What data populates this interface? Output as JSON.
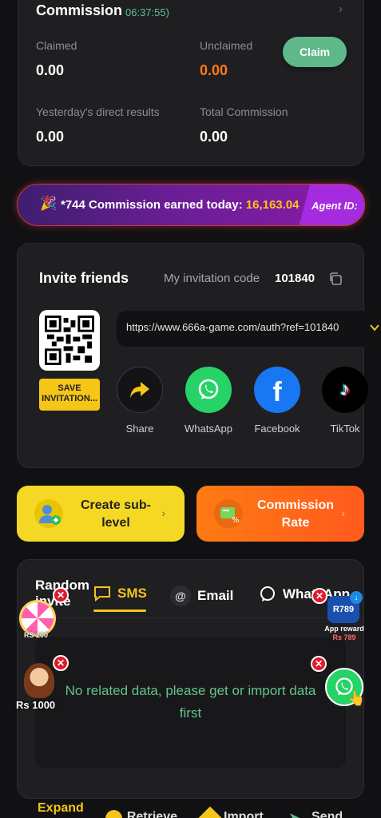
{
  "commission": {
    "title": "Commission",
    "countdown": "06:37:55)",
    "claimed_label": "Claimed",
    "claimed_value": "0.00",
    "unclaimed_label": "Unclaimed",
    "unclaimed_value": "0.00",
    "claim_button": "Claim",
    "yesterday_label": "Yesterday's direct results",
    "yesterday_value": "0.00",
    "total_label": "Total Commission",
    "total_value": "0.00"
  },
  "banner": {
    "text": "*744 Commission earned today: ",
    "amount": "16,163.04",
    "agent_label": "Agent ID:"
  },
  "invite": {
    "title": "Invite friends",
    "code_label": "My invitation code",
    "code_value": "101840",
    "save_button": "SAVE INVITATION...",
    "url": "https://www.666a-game.com/auth?ref=101840",
    "share": [
      {
        "label": "Share"
      },
      {
        "label": "WhatsApp"
      },
      {
        "label": "Facebook"
      },
      {
        "label": "TikTok"
      }
    ]
  },
  "actions": {
    "create_sub_level": "Create sub-level",
    "commission_rate": "Commission Rate"
  },
  "random_invite": {
    "title": "Random invite",
    "tabs": [
      {
        "label": "SMS",
        "active": true
      },
      {
        "label": "Email",
        "active": false
      },
      {
        "label": "WhatsApp",
        "active": false
      }
    ],
    "empty_text": "No related data, please get or import data first"
  },
  "bottom": {
    "expand": "Expand",
    "retrieve": "Retrieve",
    "import": "Import",
    "send": "Send"
  },
  "floating": {
    "spin_amount": "RS 200",
    "promo_amount": "Rs 1000",
    "app_reward_label": "App reward",
    "app_reward_amount": "Rs 789",
    "app_logo": "R789"
  },
  "colors": {
    "accent_yellow": "#f5c518",
    "accent_green": "#5fb889",
    "unclaimed_orange": "#ff7a1a",
    "banner_amount": "#ffc21a"
  }
}
